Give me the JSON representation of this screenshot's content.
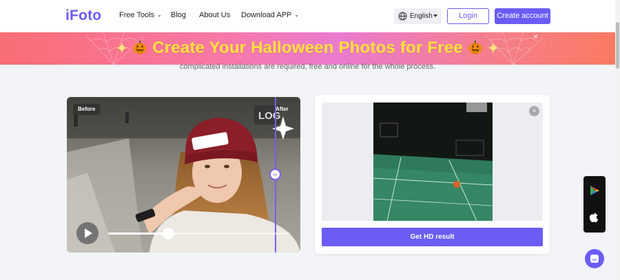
{
  "header": {
    "logo": "iFoto",
    "nav": [
      {
        "label": "Free Tools",
        "has_caret": true
      },
      {
        "label": "Blog",
        "has_caret": false
      },
      {
        "label": "About Us",
        "has_caret": false
      },
      {
        "label": "Download APP",
        "has_caret": true
      }
    ],
    "language": "English",
    "login_label": "Login",
    "create_account_label": "Create account"
  },
  "banner": {
    "text": "Create Your Halloween Photos for Free",
    "close_icon": "×"
  },
  "intro": {
    "subtitle": "complicated installations are required, free and online for the whole process."
  },
  "before_after": {
    "before_label": "Before",
    "after_label": "After",
    "playback_progress": 0.33
  },
  "result": {
    "close_icon": "×",
    "hd_button_label": "Get HD result"
  },
  "side_apps": [
    "google-play-icon",
    "apple-icon"
  ],
  "colors": {
    "brand": "#6b5cf6",
    "banner_text": "#ffe23a"
  }
}
